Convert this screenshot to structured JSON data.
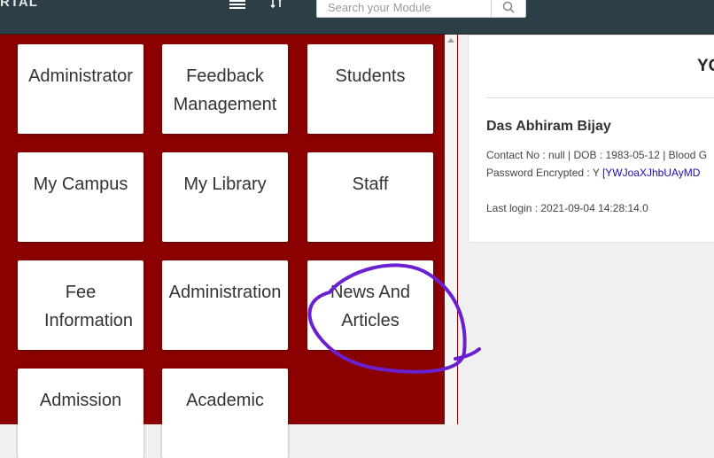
{
  "header": {
    "brand": "RTAL",
    "search": {
      "placeholder": "Search your Module",
      "value": ""
    }
  },
  "modules": [
    {
      "label": "Administrator"
    },
    {
      "label": "Feedback Management"
    },
    {
      "label": "Students"
    },
    {
      "label": "My Campus"
    },
    {
      "label": "My Library"
    },
    {
      "label": "Staff"
    },
    {
      "label": "Fee Information"
    },
    {
      "label": "Administration"
    },
    {
      "label": "News And Articles"
    },
    {
      "label": "Admission"
    },
    {
      "label": "Academic"
    }
  ],
  "profile": {
    "heading": "YO",
    "name": "Das Abhiram Bijay",
    "contact_line": "Contact No : null | DOB : 1983-05-12 | Blood G",
    "password_label": "Password Encrypted : Y",
    "password_hash": "[YWJoaXJhbUAyMD",
    "last_login": "Last login : 2021-09-04 14:28:14.0"
  },
  "colors": {
    "topbar": "#2c3e46",
    "module_panel": "#8b0000",
    "annotation": "#6a1fd1"
  },
  "icons": [
    "menu-icon",
    "switch-icon",
    "search-icon",
    "scroll-up-icon"
  ]
}
